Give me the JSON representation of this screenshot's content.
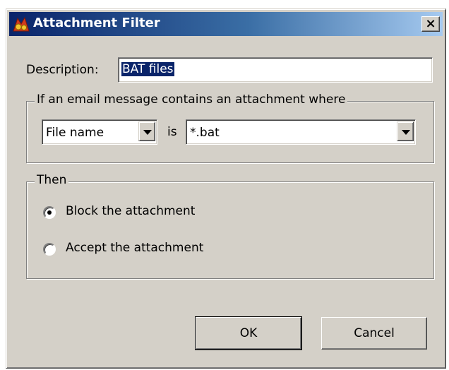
{
  "window": {
    "title": "Attachment Filter",
    "close_glyph": "×"
  },
  "description": {
    "label": "Description:",
    "value": "BAT files"
  },
  "condition_group": {
    "legend": "If an email message contains an attachment where",
    "field_combo": {
      "selected": "File name"
    },
    "operator_label": "is",
    "value_combo": {
      "selected": "*.bat"
    }
  },
  "action_group": {
    "legend": "Then",
    "options": [
      {
        "label": "Block the attachment",
        "checked": true
      },
      {
        "label": "Accept the attachment",
        "checked": false
      }
    ]
  },
  "buttons": {
    "ok": "OK",
    "cancel": "Cancel"
  },
  "icons": {
    "app": "app-icon",
    "close": "close-icon",
    "dropdown": "chevron-down-icon"
  },
  "colors": {
    "titlebar_start": "#0a246a",
    "titlebar_end": "#a6caf0",
    "dialog_bg": "#d4d0c8",
    "selection": "#0a246a"
  }
}
